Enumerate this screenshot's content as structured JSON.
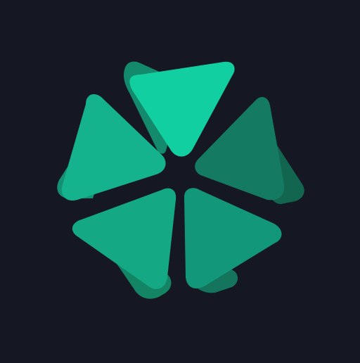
{
  "background_color": "#151722",
  "logo": {
    "icon": "five-petal-triangle-flower-icon",
    "colors": {
      "top_petal": "#12CFA2",
      "top_petal_back": "#138A6C",
      "upper_right_petal": "#157A62",
      "upper_right_petal_back": "#12654F",
      "lower_right_petal": "#13977A",
      "lower_right_petal_back": "#15745C",
      "lower_left_petal": "#15A884",
      "lower_left_petal_back": "#138564",
      "upper_left_petal": "#15B38D",
      "upper_left_petal_back": "#149074"
    }
  }
}
